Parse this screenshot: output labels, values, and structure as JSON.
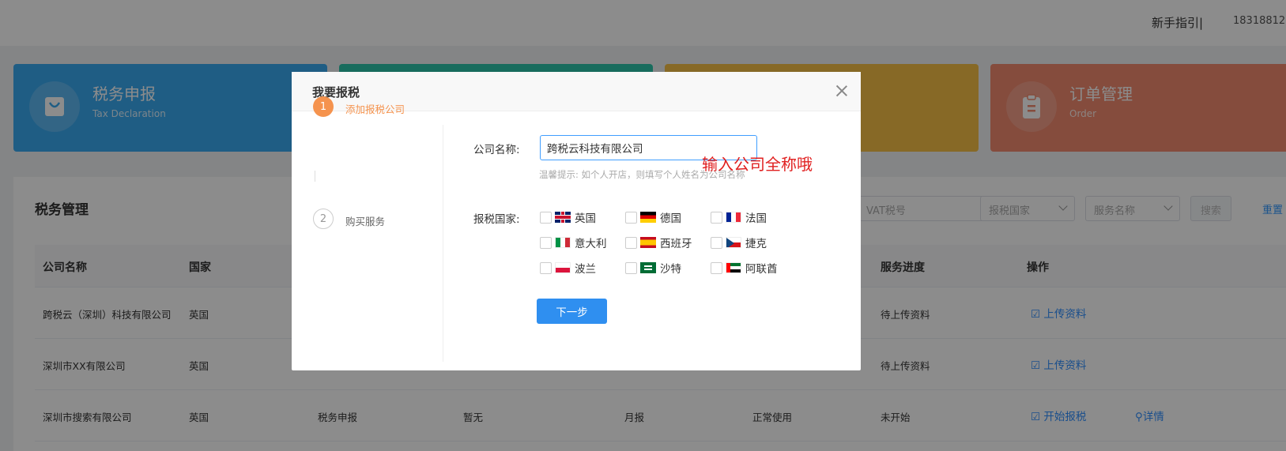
{
  "topbar": {
    "guide_label": "新手指引|",
    "phone": "18318812"
  },
  "cards": [
    {
      "title": "税务申报",
      "subtitle": "Tax Declaration",
      "icon": "bag-icon",
      "color": "#3aa9f0"
    },
    {
      "title": "",
      "subtitle": "",
      "color": "#2dc5a9"
    },
    {
      "title": "",
      "subtitle": "",
      "color": "#f6c046"
    },
    {
      "title": "订单管理",
      "subtitle": "Order",
      "icon": "clipboard-icon",
      "color": "#f28a6f"
    }
  ],
  "panel": {
    "title": "税务管理",
    "filters": {
      "vat_placeholder": "VAT税号",
      "country_placeholder": "报税国家",
      "service_placeholder": "服务名称",
      "search_label": "搜索",
      "reset_label": "重置"
    },
    "table": {
      "headers": [
        "公司名称",
        "国家",
        "服务进度",
        "操作"
      ],
      "rows": [
        {
          "company": "跨税云（深圳）科技有限公司",
          "country": "英国",
          "service": "",
          "vat": "",
          "period": "",
          "status": "",
          "progress": "待上传资料",
          "action": "上传资料",
          "detail": ""
        },
        {
          "company": "深圳市XX有限公司",
          "country": "英国",
          "service": "",
          "vat": "",
          "period": "",
          "status": "",
          "progress": "待上传资料",
          "action": "上传资料",
          "detail": ""
        },
        {
          "company": "深圳市搜索有限公司",
          "country": "英国",
          "service": "税务申报",
          "vat": "暂无",
          "period": "月报",
          "status": "正常使用",
          "progress": "未开始",
          "action": "开始报税",
          "detail": "详情"
        }
      ]
    }
  },
  "modal": {
    "title": "我要报税",
    "steps": [
      {
        "num": "1",
        "label": "添加报税公司",
        "active": true
      },
      {
        "num": "2",
        "label": "购买服务",
        "active": false
      }
    ],
    "company_label": "公司名称:",
    "company_value": "跨税云科技有限公司",
    "hint": "温馨提示: 如个人开店，则填写个人姓名为公司名称",
    "annotation": "输入公司全称哦",
    "countries_label": "报税国家:",
    "countries": [
      {
        "name": "英国",
        "flag": "uk"
      },
      {
        "name": "德国",
        "flag": "de"
      },
      {
        "name": "法国",
        "flag": "fr"
      },
      {
        "name": "意大利",
        "flag": "it"
      },
      {
        "name": "西班牙",
        "flag": "es"
      },
      {
        "name": "捷克",
        "flag": "cz"
      },
      {
        "name": "波兰",
        "flag": "pl"
      },
      {
        "name": "沙特",
        "flag": "sa"
      },
      {
        "name": "阿联酋",
        "flag": "ae"
      }
    ],
    "next_label": "下一步"
  }
}
